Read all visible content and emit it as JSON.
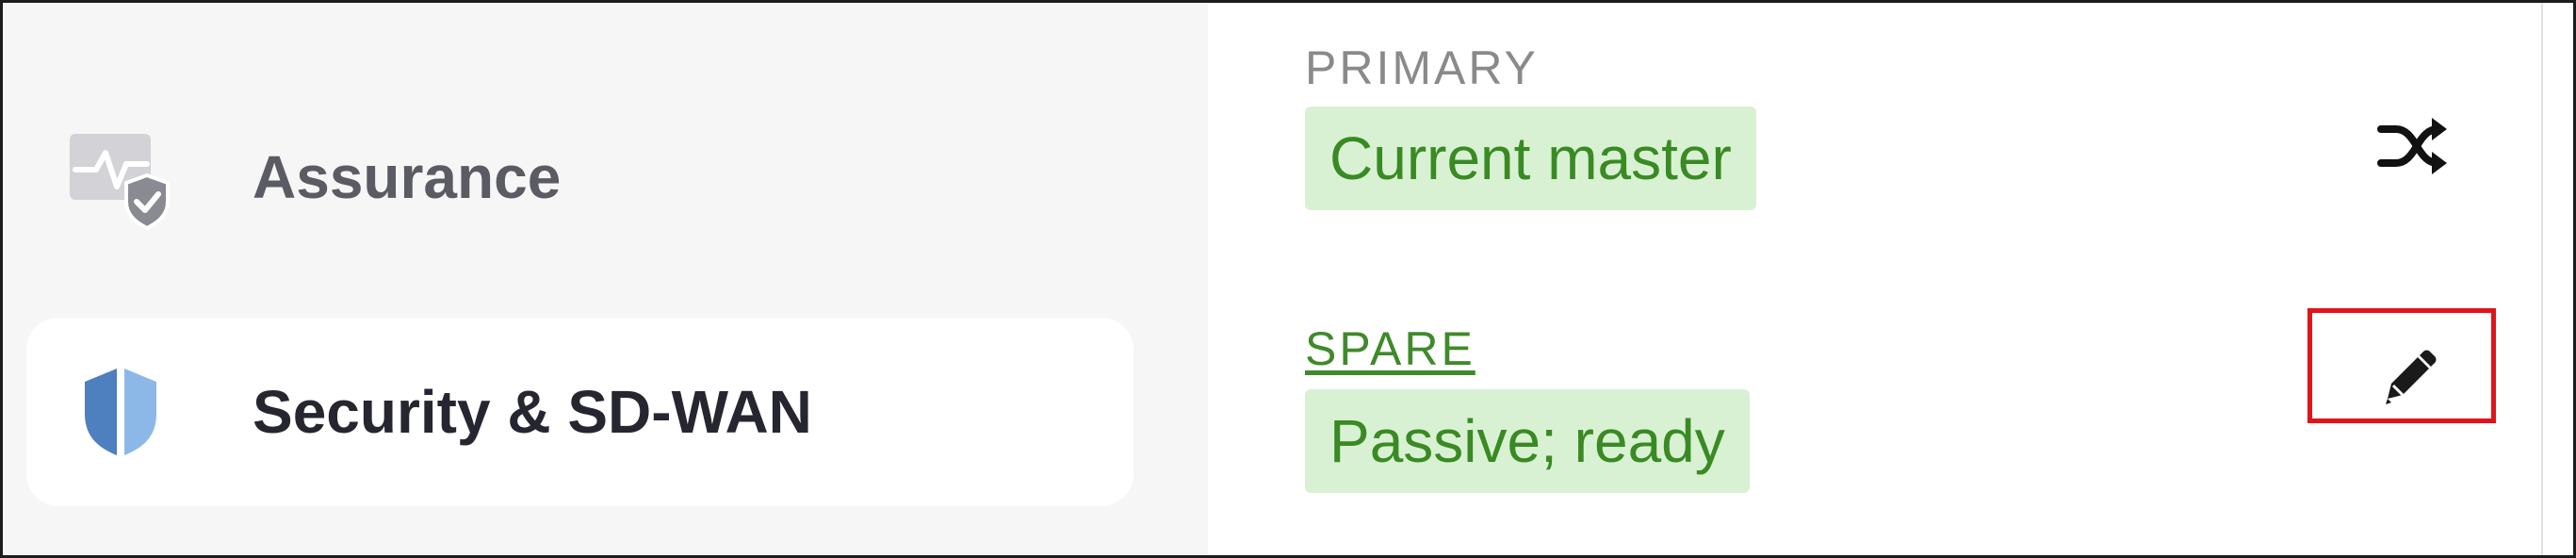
{
  "sidebar": {
    "items": [
      {
        "label": "Assurance",
        "icon": "monitor-shield-icon",
        "selected": false
      },
      {
        "label": "Security & SD-WAN",
        "icon": "shield-icon",
        "selected": true
      }
    ]
  },
  "appliances": [
    {
      "role": "PRIMARY",
      "status": "Current master",
      "action_icon": "shuffle-icon"
    },
    {
      "role": "SPARE",
      "status": "Passive; ready",
      "action_icon": "pencil-icon"
    }
  ],
  "colors": {
    "sidebar_bg": "#f6f6f6",
    "badge_bg": "#d8f1d3",
    "badge_text": "#3a8a23",
    "spare_link": "#3f8a2a",
    "highlight": "#e0141a",
    "shield_blue": "#6e9fd6"
  }
}
